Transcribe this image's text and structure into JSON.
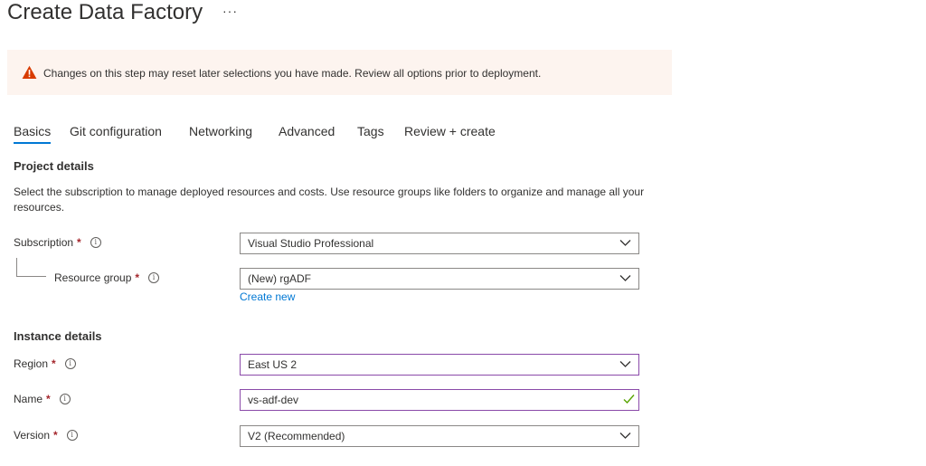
{
  "page": {
    "title": "Create Data Factory",
    "more": "···"
  },
  "banner": {
    "icon": "warning-icon",
    "text": "Changes on this step may reset later selections you have made. Review all options prior to deployment."
  },
  "tabs": [
    {
      "label": "Basics",
      "active": true
    },
    {
      "label": "Git configuration"
    },
    {
      "label": "Networking"
    },
    {
      "label": "Advanced"
    },
    {
      "label": "Tags"
    },
    {
      "label": "Review + create"
    }
  ],
  "project": {
    "heading": "Project details",
    "description": "Select the subscription to manage deployed resources and costs. Use resource groups like folders to organize and manage all your resources.",
    "subscription": {
      "label": "Subscription",
      "required": "*",
      "value": "Visual Studio Professional"
    },
    "resource_group": {
      "label": "Resource group",
      "required": "*",
      "value": "(New) rgADF",
      "create_new": "Create new"
    }
  },
  "instance": {
    "heading": "Instance details",
    "region": {
      "label": "Region",
      "required": "*",
      "value": "East US 2"
    },
    "name": {
      "label": "Name",
      "required": "*",
      "value": "vs-adf-dev"
    },
    "version": {
      "label": "Version",
      "required": "*",
      "value": "V2 (Recommended)"
    }
  },
  "colors": {
    "accent": "#0078d4",
    "required": "#a4262c",
    "warning": "#d83b01",
    "banner_bg": "#fdf4ef",
    "focus_border": "#8a4aa9",
    "valid_check": "#57a300"
  }
}
